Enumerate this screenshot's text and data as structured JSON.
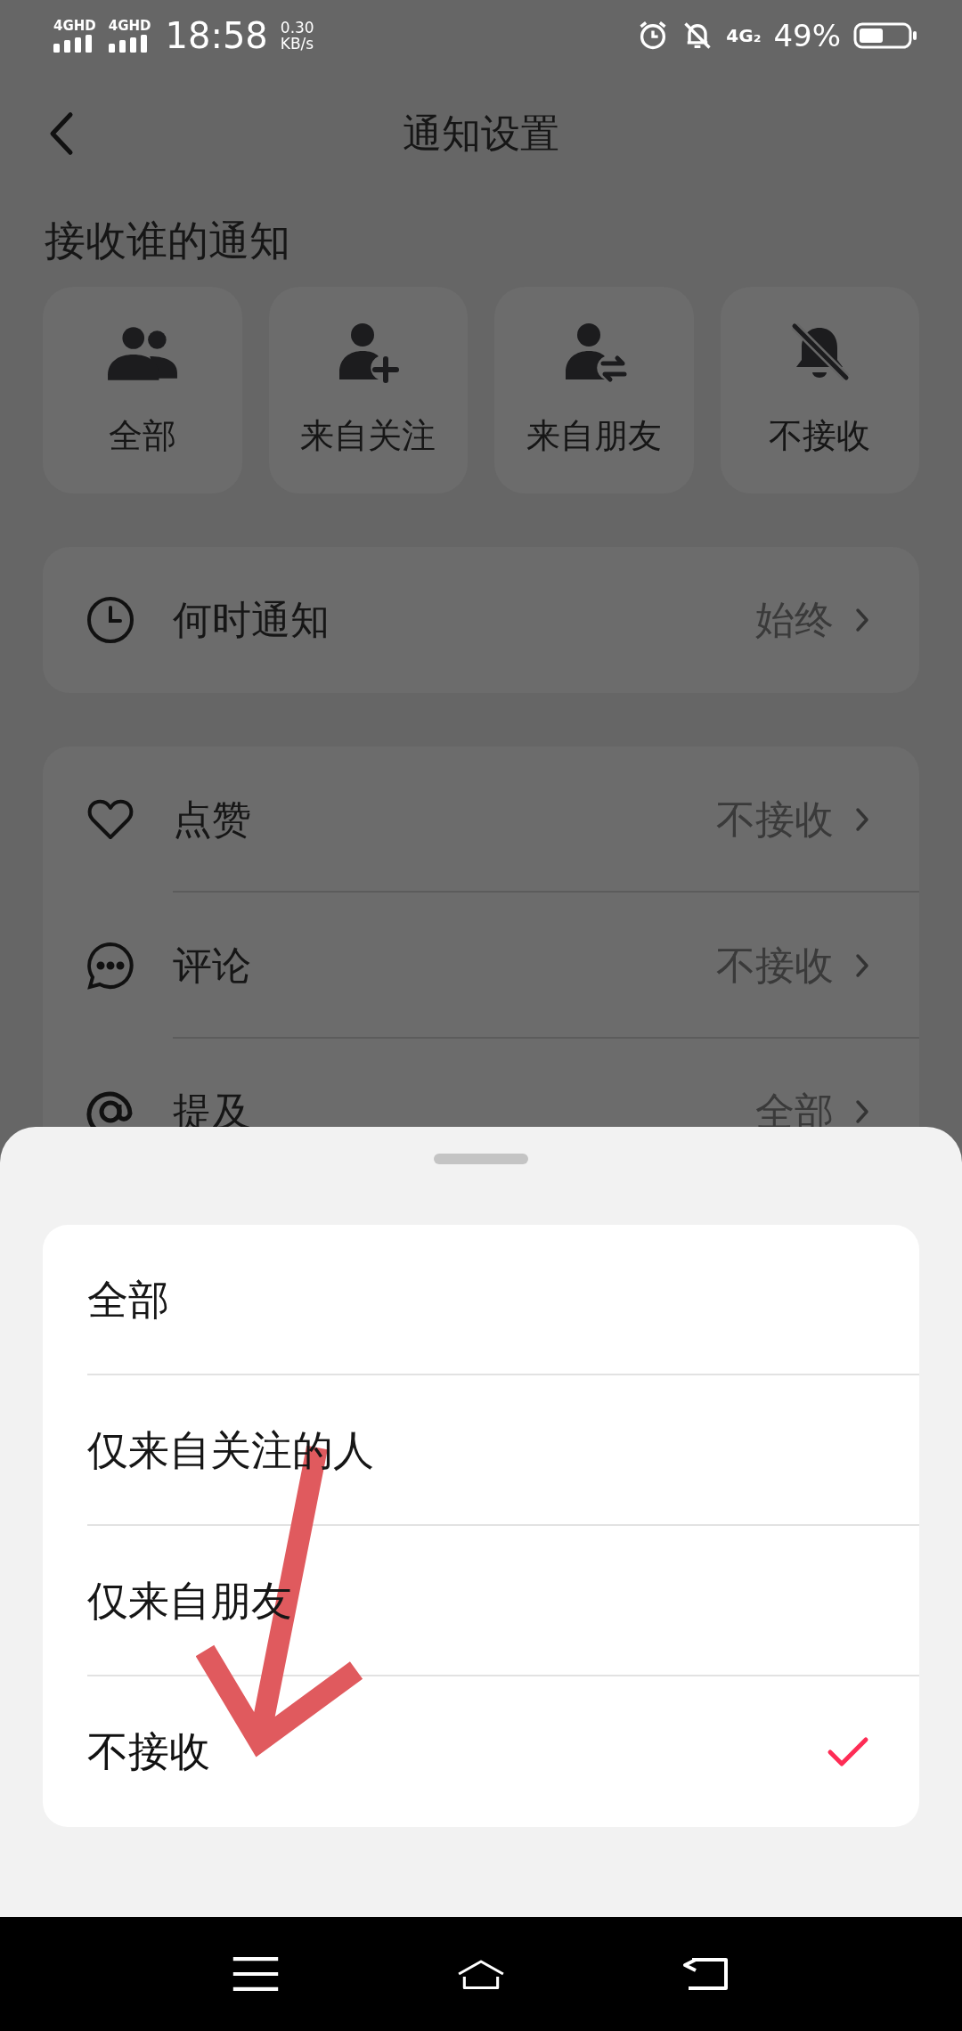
{
  "status_bar": {
    "network_1": "4GHD",
    "network_2": "4GHD",
    "time": "18:58",
    "speed_value": "0.30",
    "speed_unit": "KB/s",
    "network_3": "4G₂",
    "battery": "49%"
  },
  "header": {
    "title": "通知设置"
  },
  "section_title": "接收谁的通知",
  "audience_tiles": [
    {
      "kind": "all",
      "label": "全部"
    },
    {
      "kind": "following",
      "label": "来自关注"
    },
    {
      "kind": "friends",
      "label": "来自朋友"
    },
    {
      "kind": "none",
      "label": "不接收"
    }
  ],
  "when": {
    "label": "何时通知",
    "value": "始终"
  },
  "settings": [
    {
      "kind": "like",
      "label": "点赞",
      "value": "不接收"
    },
    {
      "kind": "comment",
      "label": "评论",
      "value": "不接收"
    },
    {
      "kind": "mention",
      "label": "提及",
      "value": "全部"
    }
  ],
  "sheet": {
    "options": [
      {
        "label": "全部",
        "selected": false
      },
      {
        "label": "仅来自关注的人",
        "selected": false
      },
      {
        "label": "仅来自朋友",
        "selected": false
      },
      {
        "label": "不接收",
        "selected": true
      }
    ]
  }
}
